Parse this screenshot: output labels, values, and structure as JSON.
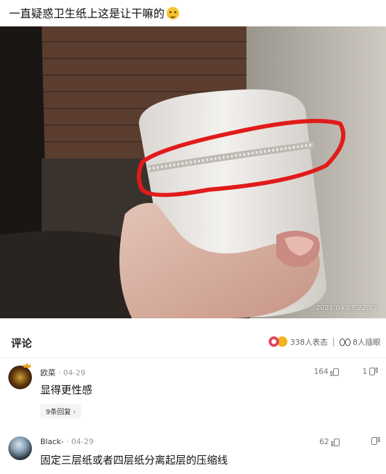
{
  "post": {
    "title": "一直疑惑卫生纸上这是让干嘛的"
  },
  "photo": {
    "timestamp": "2021.04.28 22:57",
    "annotation_color": "#e11b1b"
  },
  "comments_section": {
    "title": "评论",
    "reactions_text": "338人表态",
    "watchers_text": "8人插眼"
  },
  "comments": [
    {
      "name": "欧菜",
      "date": "· 04-29",
      "text": "显得更性感",
      "likes": "164",
      "dislikes": "1",
      "replies_label": "9条回复",
      "replies_chevron": "›"
    },
    {
      "name": "Black-",
      "date": "· 04-29",
      "text": "固定三层纸或者四层纸分离起层的压缩线",
      "likes": "62",
      "dislikes": ""
    }
  ],
  "icons": [
    "emoji-smile-icon",
    "reaction-heart-icon",
    "reaction-emoji-icon",
    "eyes-icon",
    "thumb-up-icon",
    "thumb-down-icon",
    "chevron-right-icon"
  ]
}
